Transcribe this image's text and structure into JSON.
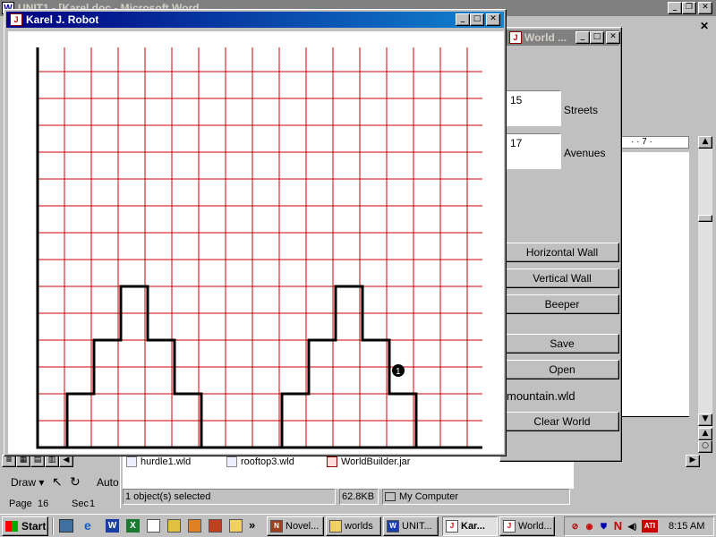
{
  "word": {
    "title": "UNIT1 - [Karel.doc - Microsoft Word",
    "page_label": "Page",
    "page_num": "16",
    "sec_label": "Sec",
    "sec_num": "1",
    "draw_label": "Draw",
    "autoshapes_label": "Auto",
    "ruler_marks": "· · 7 ·"
  },
  "karel": {
    "title": "Karel J. Robot",
    "beeper_count": "1",
    "grid_color": "#cc0000",
    "wall_color": "#000000"
  },
  "world_builder": {
    "title": "World ...",
    "streets_value": "15",
    "streets_label": "Streets",
    "avenues_value": "17",
    "avenues_label": "Avenues",
    "horizontal_wall_label": "Horizontal Wall",
    "vertical_wall_label": "Vertical Wall",
    "beeper_label": "Beeper",
    "save_label": "Save",
    "open_label": "Open",
    "filename": "mountain.wld",
    "clear_world_label": "Clear World"
  },
  "explorer": {
    "files": [
      "hurdle1.wld",
      "rooftop3.wld",
      "WorldBuilder.jar"
    ],
    "status_selected": "1 object(s) selected",
    "status_size": "62.8KB",
    "status_location": "My Computer"
  },
  "taskbar": {
    "start_label": "Start",
    "more_label": "»",
    "buttons": [
      {
        "label": "Novel...",
        "icon": "N"
      },
      {
        "label": "worlds",
        "icon": "F"
      },
      {
        "label": "UNIT...",
        "icon": "W"
      },
      {
        "label": "Kar...",
        "icon": "K"
      },
      {
        "label": "World...",
        "icon": "K"
      }
    ],
    "clock": "8:15 AM"
  }
}
